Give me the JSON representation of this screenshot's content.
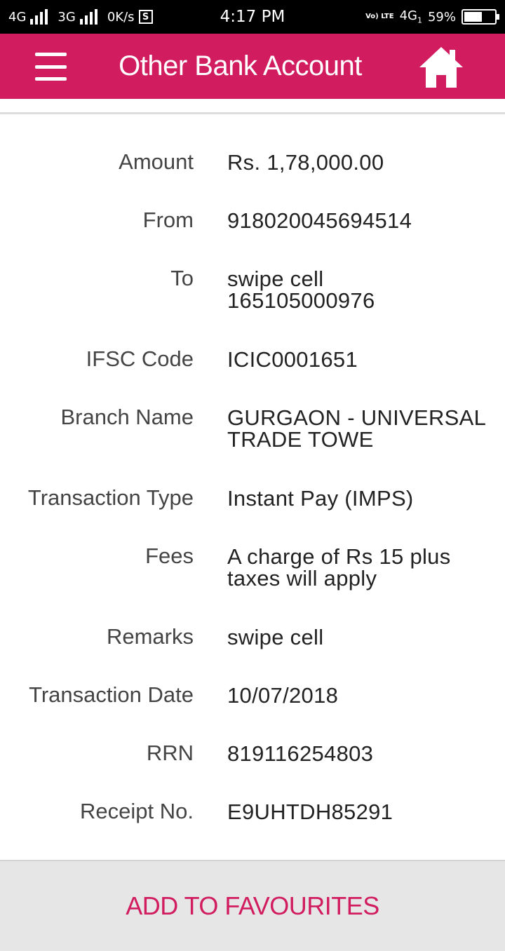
{
  "status_bar": {
    "network1": "4G",
    "network2": "3G",
    "speed": "0K/s",
    "s_badge": "S",
    "time": "4:17 PM",
    "volte": "Vo) LTE",
    "network_right": "4G",
    "sim_index": "1",
    "battery_pct_text": "59%",
    "battery_level": 0.59
  },
  "app_bar": {
    "title": "Other Bank Account",
    "menu_icon": "hamburger-menu-icon",
    "home_icon": "home-icon",
    "bg_color": "#d11d5f"
  },
  "details": [
    {
      "label": "Amount",
      "value": "Rs. 1,78,000.00"
    },
    {
      "label": "From",
      "value": "918020045694514"
    },
    {
      "label": "To",
      "value": "swipe cell 165105000976"
    },
    {
      "label": "IFSC Code",
      "value": "ICIC0001651"
    },
    {
      "label": "Branch Name",
      "value": "GURGAON - UNIVERSAL TRADE TOWE"
    },
    {
      "label": "Transaction Type",
      "value": "Instant Pay (IMPS)"
    },
    {
      "label": "Fees",
      "value": "A charge of Rs 15 plus taxes will apply"
    },
    {
      "label": "Remarks",
      "value": "swipe cell"
    },
    {
      "label": "Transaction Date",
      "value": "10/07/2018"
    },
    {
      "label": "RRN",
      "value": "819116254803"
    },
    {
      "label": "Receipt No.",
      "value": "E9UHTDH85291"
    }
  ],
  "footer": {
    "button_label": "ADD TO FAVOURITES"
  }
}
